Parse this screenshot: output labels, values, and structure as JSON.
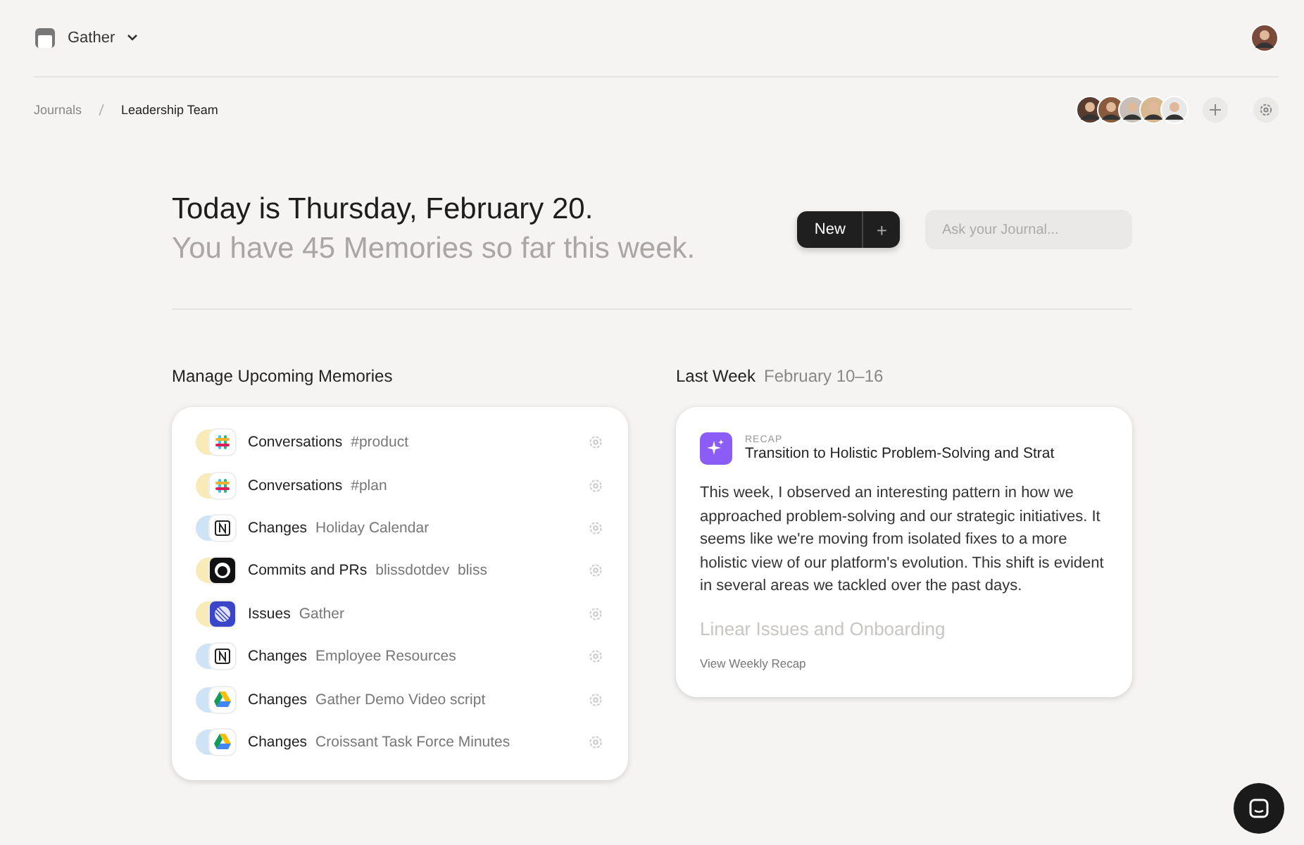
{
  "workspace": {
    "name": "Gather"
  },
  "breadcrumb": [
    {
      "label": "Journals"
    },
    {
      "label": "Leadership Team"
    }
  ],
  "hero": {
    "title": "Today is Thursday, February 20.",
    "subtitle": "You have 45 Memories so far this week.",
    "new_button": "New",
    "add_button": "+",
    "search": {
      "placeholder": "Ask your Journal..."
    }
  },
  "upcoming": {
    "heading": "Manage Upcoming Memories",
    "items": [
      {
        "kind": "slack",
        "color": "#f8ebb8",
        "label": "Conversations",
        "detail": "#product"
      },
      {
        "kind": "slack",
        "color": "#f8ebb8",
        "label": "Conversations",
        "detail": "#plan"
      },
      {
        "kind": "notion",
        "color": "#cfe3f7",
        "label": "Changes",
        "detail": "Holiday Calendar"
      },
      {
        "kind": "github",
        "color": "#f8ebb8",
        "label": "Commits and PRs",
        "detail": "blissdotdev  bliss"
      },
      {
        "kind": "linear",
        "color": "#f8ebb8",
        "label": "Issues",
        "detail": "Gather"
      },
      {
        "kind": "notion",
        "color": "#cfe3f7",
        "label": "Changes",
        "detail": "Employee Resources"
      },
      {
        "kind": "gdrive",
        "color": "#cfe3f7",
        "label": "Changes",
        "detail": "Gather Demo Video script"
      },
      {
        "kind": "gdrive",
        "color": "#cfe3f7",
        "label": "Changes",
        "detail": "Croissant Task Force Minutes"
      }
    ]
  },
  "last_week": {
    "heading": "Last Week",
    "range": "February 10–16",
    "recap": {
      "tag": "RECAP",
      "title": "Transition to Holistic Problem-Solving and Strat",
      "body": "This week, I observed an interesting pattern in how we approached problem-solving and our strategic initiatives. It seems like we're moving from isolated fixes to a more holistic view of our platform's evolution. This shift is evident in several areas we tackled over the past days.",
      "subheading": "Linear Issues and Onboarding",
      "link": "View Weekly Recap"
    }
  }
}
